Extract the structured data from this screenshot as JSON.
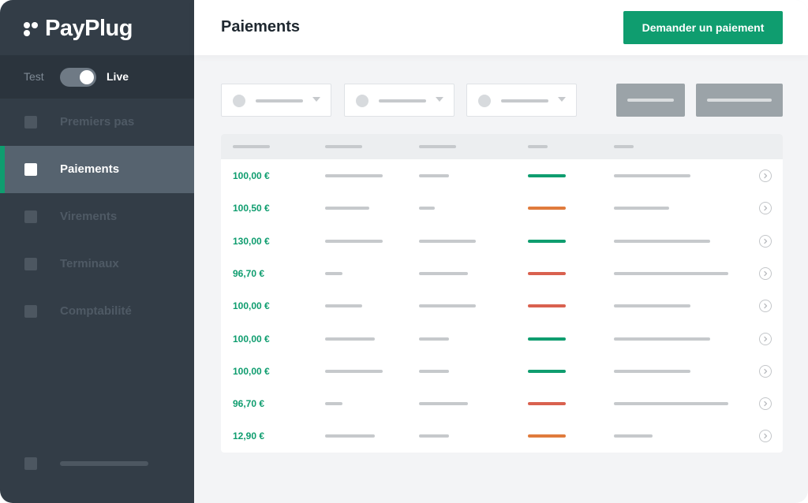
{
  "brand": {
    "name": "PayPlug"
  },
  "mode": {
    "test_label": "Test",
    "live_label": "Live",
    "live_enabled": true
  },
  "nav": {
    "items": [
      {
        "label": "Premiers pas",
        "active": false
      },
      {
        "label": "Paiements",
        "active": true
      },
      {
        "label": "Virements",
        "active": false
      },
      {
        "label": "Terminaux",
        "active": false
      },
      {
        "label": "Comptabilité",
        "active": false
      }
    ]
  },
  "header": {
    "title": "Paiements",
    "cta_label": "Demander un paiement"
  },
  "colors": {
    "accent": "#0f9d6f",
    "status_success": "#0f9d6f",
    "status_pending": "#e07b3c",
    "status_failed": "#d9614f",
    "sidebar": "#333d47"
  },
  "payments": [
    {
      "amount": "100,00 €",
      "status": "success"
    },
    {
      "amount": "100,50 €",
      "status": "pending"
    },
    {
      "amount": "130,00 €",
      "status": "success"
    },
    {
      "amount": "96,70 €",
      "status": "failed"
    },
    {
      "amount": "100,00 €",
      "status": "failed"
    },
    {
      "amount": "100,00 €",
      "status": "success"
    },
    {
      "amount": "100,00 €",
      "status": "success"
    },
    {
      "amount": "96,70 €",
      "status": "failed"
    },
    {
      "amount": "12,90 €",
      "status": "pending"
    }
  ]
}
